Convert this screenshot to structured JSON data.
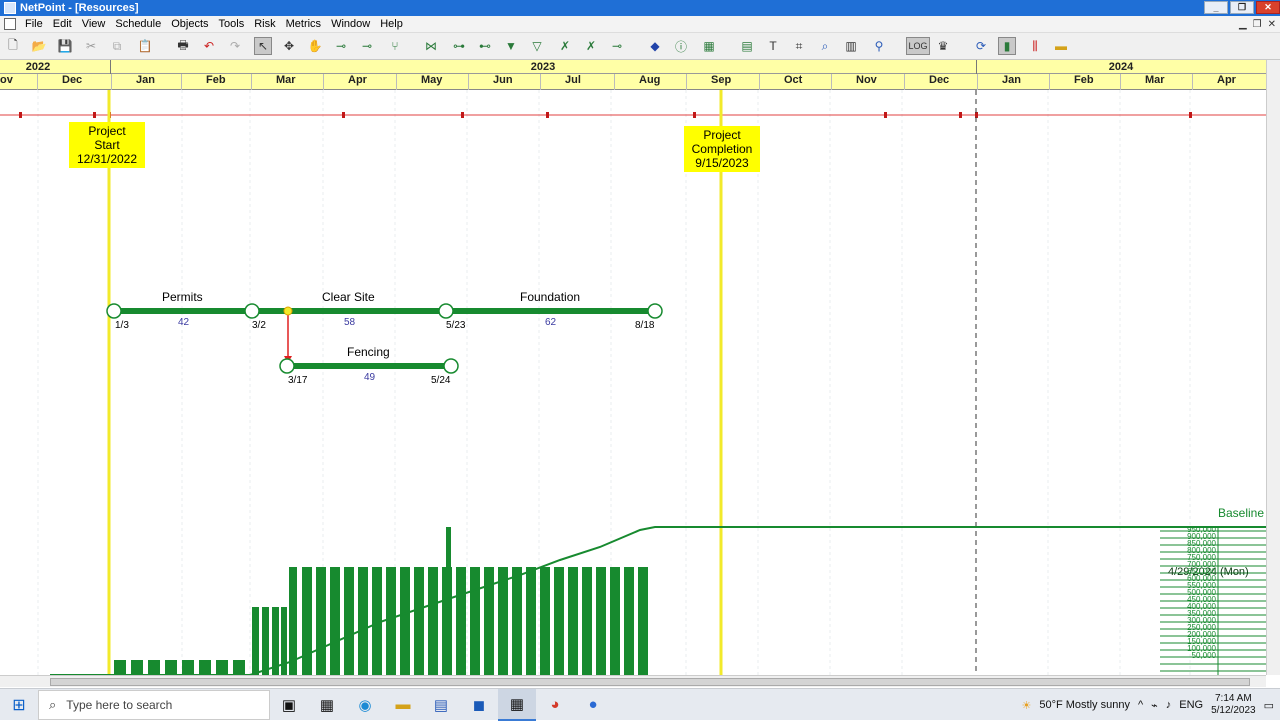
{
  "window": {
    "title": "NetPoint - [Resources]",
    "minimize": "_",
    "restore": "❐",
    "close": "✕"
  },
  "menu": [
    "File",
    "Edit",
    "View",
    "Schedule",
    "Objects",
    "Tools",
    "Risk",
    "Metrics",
    "Window",
    "Help"
  ],
  "toolbar_icons": [
    "new-icon",
    "open-icon",
    "save-icon",
    "cut-icon",
    "copy-icon",
    "paste-icon",
    "print-icon",
    "undo-icon",
    "redo-icon",
    "select-icon",
    "add-activity-icon",
    "pan-icon",
    "link-icon",
    "link2-icon",
    "fork-icon",
    "chain-icon",
    "chain2-icon",
    "chain3-icon",
    "filter-icon",
    "filter2-icon",
    "filter3-icon",
    "filter4-icon",
    "node-icon",
    "milestone-icon",
    "info-icon",
    "group-icon",
    "table-icon",
    "text-icon",
    "camera-icon",
    "zoom-icon",
    "grid-icon",
    "pin-icon",
    "logic-icon",
    "crown-icon",
    "cycle-icon",
    "histogram-icon",
    "bars-icon",
    "resource-icon"
  ],
  "timescale": {
    "years": [
      {
        "label": "2022"
      },
      {
        "label": "2023"
      },
      {
        "label": "2024"
      }
    ],
    "months": [
      "ov",
      "Dec",
      "Jan",
      "Feb",
      "Mar",
      "Apr",
      "May",
      "Jun",
      "Jul",
      "Aug",
      "Sep",
      "Oct",
      "Nov",
      "Dec",
      "Jan",
      "Feb",
      "Mar",
      "Apr"
    ]
  },
  "notes": {
    "start": {
      "line1": "Project",
      "line2": "Start",
      "line3": "12/31/2022"
    },
    "completion": {
      "line1": "Project",
      "line2": "Completion",
      "line3": "9/15/2023"
    }
  },
  "activities": [
    {
      "name": "Permits",
      "duration": "42",
      "start": "1/3",
      "finish": "3/2"
    },
    {
      "name": "Clear Site",
      "duration": "58",
      "start": "3/2",
      "finish": "5/23"
    },
    {
      "name": "Foundation",
      "duration": "62",
      "start": "5/23",
      "finish": "8/18"
    },
    {
      "name": "Fencing",
      "duration": "49",
      "start": "3/17",
      "finish": "5/24"
    }
  ],
  "histogram": {
    "baseline_label": "Baseline",
    "date_overlay": "4/29/2024 (Mon)",
    "axis_ticks": [
      "950,000",
      "900,000",
      "850,000",
      "800,000",
      "750,000",
      "700,000",
      "650,000",
      "600,000",
      "550,000",
      "500,000",
      "450,000",
      "400,000",
      "350,000",
      "300,000",
      "250,000",
      "200,000",
      "150,000",
      "100,000",
      "50,000"
    ]
  },
  "taskbar": {
    "search_placeholder": "Type here to search",
    "weather": "50°F  Mostly sunny",
    "language": "ENG",
    "time": "7:14 AM",
    "date": "5/12/2023"
  },
  "colors": {
    "bar_green": "#178a2f",
    "timescale_yellow": "#ffffa6",
    "note_yellow": "#ffff00",
    "title_blue": "#1f6fd6"
  }
}
